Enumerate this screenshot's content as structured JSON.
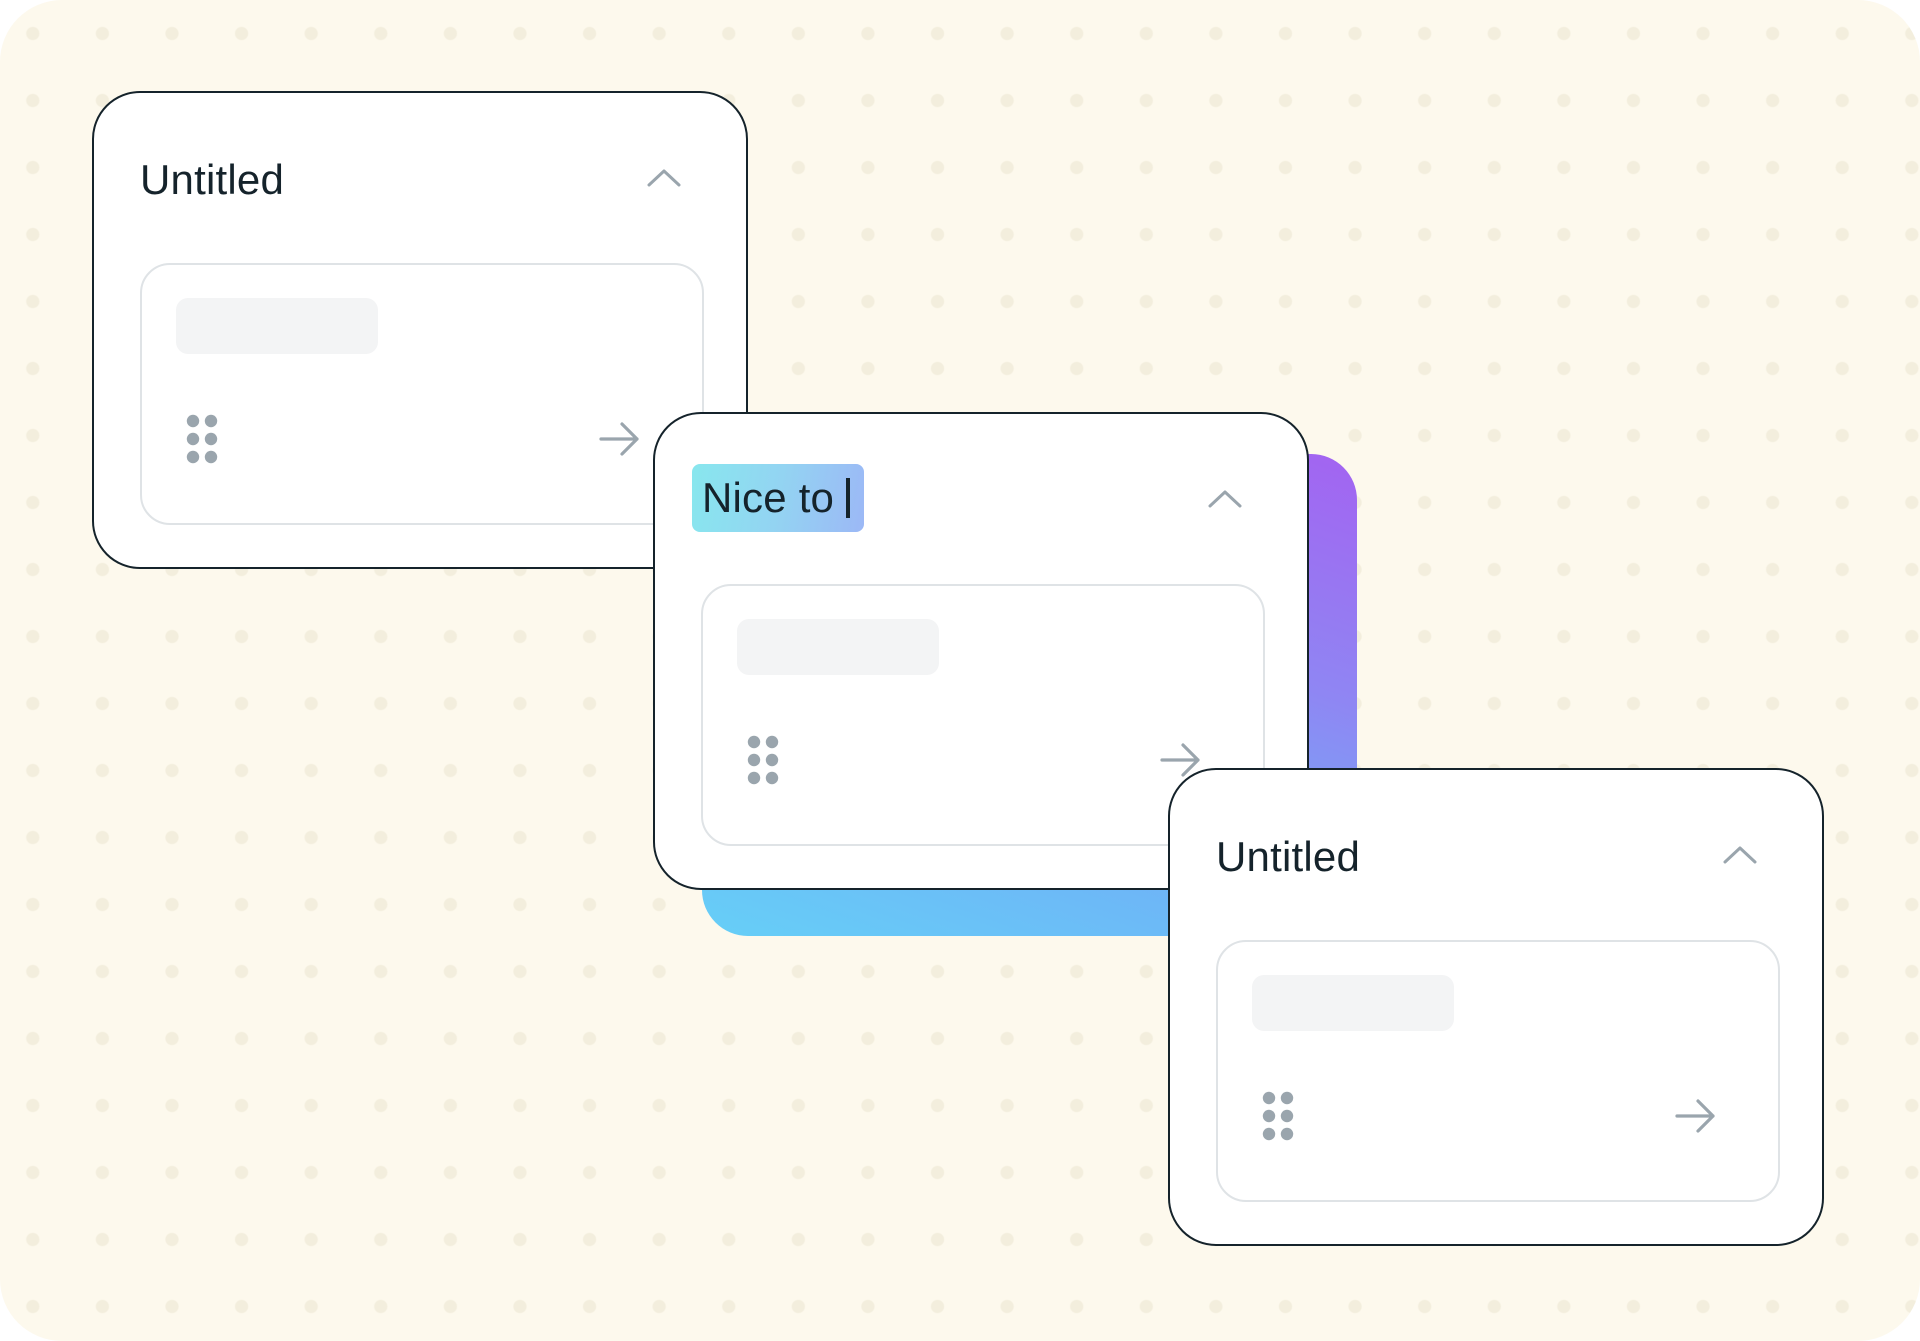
{
  "cards": [
    {
      "title": "Untitled",
      "title_editing": false
    },
    {
      "title": "Nice to",
      "title_editing": true
    },
    {
      "title": "Untitled",
      "title_editing": false
    }
  ],
  "icons": {
    "collapse": "chevron-up-icon",
    "drag": "drag-handle-icon",
    "next": "arrow-right-icon"
  },
  "colors": {
    "background": "#fdf9ed",
    "card_border": "#15232b",
    "icon": "#9aa5ad",
    "highlight": "#8fd8f1",
    "glow_top": "#a363f1",
    "glow_bottom": "#66cff7"
  }
}
